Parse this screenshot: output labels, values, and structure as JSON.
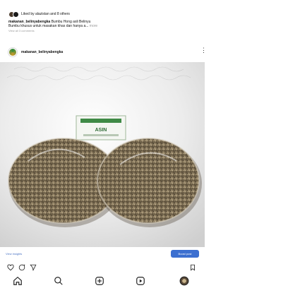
{
  "likes": {
    "text": "Liked by alazistan and 8 others"
  },
  "caption": {
    "username": "makanan_belinyabengka",
    "text_line1": " Bumbu Hong asli Belinyu",
    "text_line2": "Bumbu khusus untuk masakan khas dan hanya a...",
    "more": "more"
  },
  "comments_link": "View all 3 comments",
  "time_ago": "",
  "post": {
    "username": "makanan_belinyabengka",
    "menu_icon": "more-vertical-icon",
    "photo_alt_icon": "food-photo",
    "photo_label": "ASIN"
  },
  "insights": {
    "view_label": "View insights",
    "boost_label": "Boost post"
  },
  "actions": [
    {
      "name": "like-icon"
    },
    {
      "name": "comment-icon"
    },
    {
      "name": "share-icon"
    },
    {
      "name": "save-icon"
    }
  ],
  "bottom_nav": [
    {
      "name": "home-icon"
    },
    {
      "name": "search-icon"
    },
    {
      "name": "add-post-icon"
    },
    {
      "name": "activity-icon"
    },
    {
      "name": "profile-icon"
    }
  ],
  "colors": {
    "accent": "#3c6fd0",
    "link": "#4a73c4",
    "muted": "#9a9a9a"
  }
}
